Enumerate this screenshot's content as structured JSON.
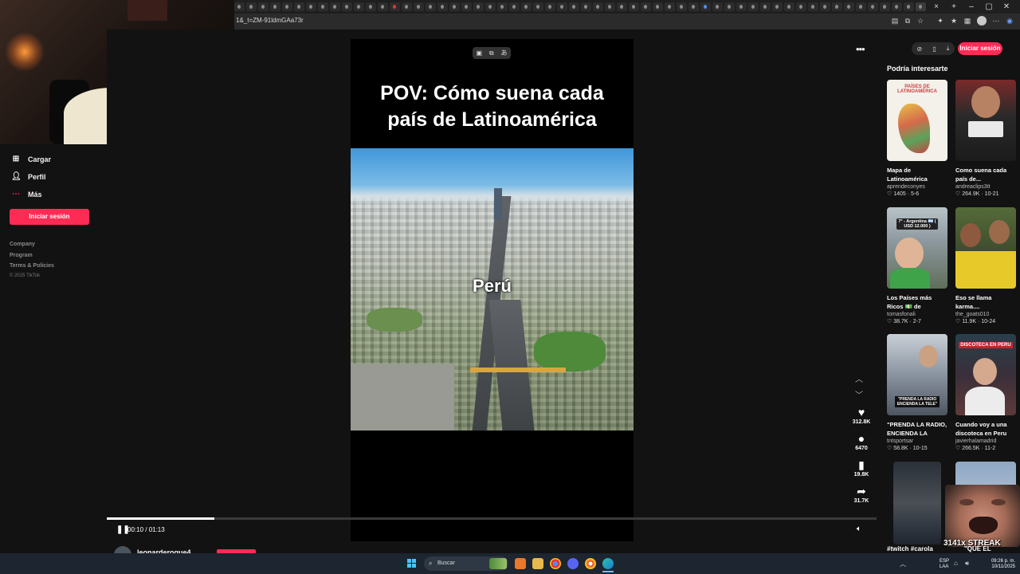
{
  "browser": {
    "url": "1&_t=ZM-91ldmGAa73r"
  },
  "sidebar": {
    "items": [
      {
        "label": "Cargar",
        "icon": "upload-icon"
      },
      {
        "label": "Perfil",
        "icon": "profile-icon"
      },
      {
        "label": "Más",
        "icon": "more-dots-icon"
      }
    ],
    "login_label": "Iniciar sesión",
    "footer_links": [
      "Company",
      "Program",
      "Terms & Policies"
    ],
    "copyright": "© 2025 TikTok"
  },
  "video": {
    "title_line1": "POV: Cómo suena cada",
    "title_line2": "país de Latinoamérica",
    "city_label": "Perú",
    "time": "00:10 / 01:13",
    "progress": 0.14,
    "author": "leonarderoque4"
  },
  "actions": [
    {
      "name": "like",
      "glyph": "♥",
      "count": "312.8K"
    },
    {
      "name": "comment",
      "glyph": "●",
      "count": "6470"
    },
    {
      "name": "save",
      "glyph": "▮",
      "count": "19.8K"
    },
    {
      "name": "share",
      "glyph": "➦",
      "count": "31.7K"
    }
  ],
  "right_panel": {
    "login_label": "Iniciar sesión",
    "heading": "Podría interesarte",
    "cards": [
      {
        "title": "Mapa de Latinoamérica",
        "author": "aprendeconyes",
        "stats": "♡ 1405 · 5-6",
        "thumb_text": "PAÍSES DE LATINOAMÉRICA"
      },
      {
        "title": "Como suena cada país de...",
        "author": "andreaclips3tt",
        "stats": "♡ 264.9K · 10-21",
        "thumb_text": ""
      },
      {
        "title": "Los Países más Ricos 💵 de Latinoaméric...",
        "author": "tomasfonali",
        "stats": "♡ 38.7K · 2-7",
        "thumb_text": "7° - Argentina 🇦🇷 ( USD 12.000 )"
      },
      {
        "title": "Eso se llama karma....",
        "author": "the_goats010",
        "stats": "♡ 11.9K · 10-24",
        "thumb_text": ""
      },
      {
        "title": "\"PRENDA LA RADIO, ENCIENDA LA TELE...",
        "author": "tntsportsar",
        "stats": "♡ 58.8K · 10-15",
        "thumb_text": "\"PRENDA LA RADIO ENCIENDA LA TELE\""
      },
      {
        "title": "Cuando voy a una discoteca en Peru",
        "author": "javierhalamadrid",
        "stats": "♡ 266.5K · 11-2",
        "thumb_text": "DISCOTECA EN PERU"
      }
    ],
    "bottom_caption_1": "#twitch #carola",
    "bottom_caption_2": "\"QUE EL"
  },
  "stream": {
    "streak_label": "3141x STREAK"
  },
  "taskbar": {
    "search_label": "Buscar",
    "lang_line1": "ESP",
    "lang_line2": "LAA",
    "clock_time": "09:26 p. m.",
    "clock_date": "10/11/2025"
  },
  "colors": {
    "brand": "#fe2c55",
    "background": "#121212"
  }
}
